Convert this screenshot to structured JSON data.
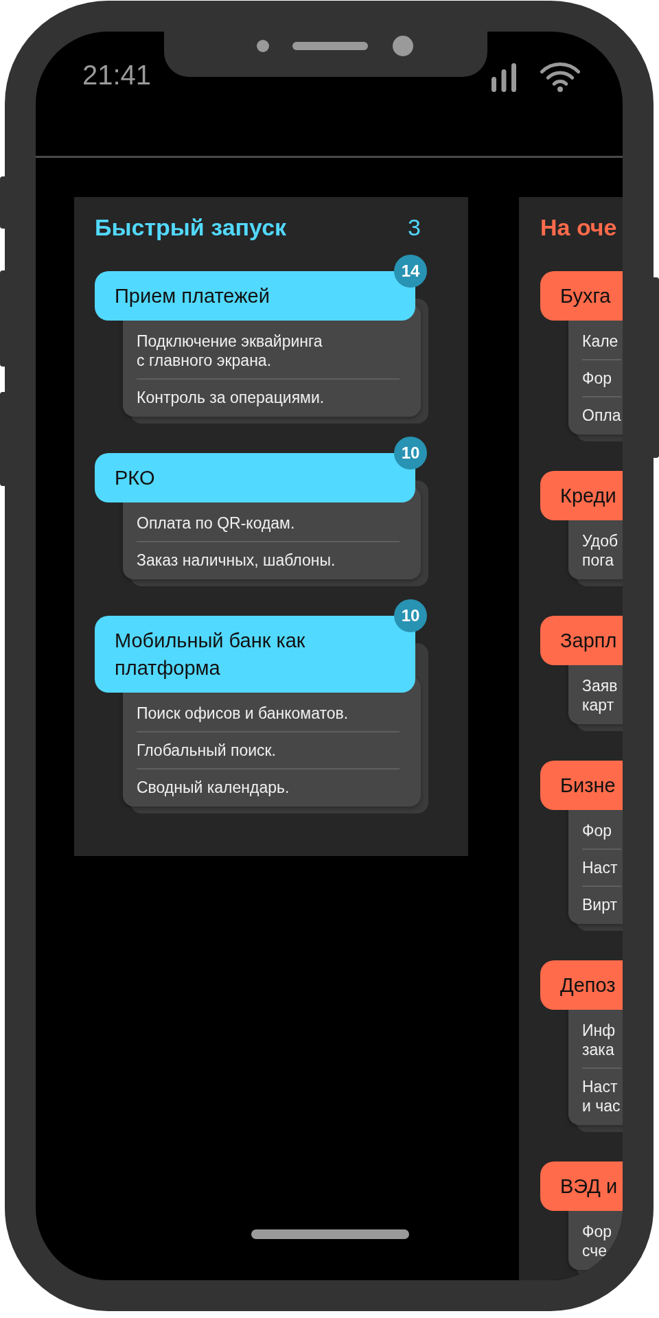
{
  "status_bar": {
    "time": "21:41"
  },
  "columns": [
    {
      "title": "Быстрый запуск",
      "count": "3",
      "color": "#52d9ff",
      "cards": [
        {
          "title": "Прием платежей",
          "badge": "14",
          "items": [
            "Подключение эквайринга\nс главного экрана.",
            "Контроль за операциями."
          ]
        },
        {
          "title": "РКО",
          "badge": "10",
          "items": [
            "Оплата по QR-кодам.",
            "Заказ наличных, шаблоны."
          ]
        },
        {
          "title": "Мобильный банк как\nплатформа",
          "badge": "10",
          "items": [
            "Поиск офисов и банкоматов.",
            "Глобальный поиск.",
            "Сводный календарь."
          ]
        }
      ]
    },
    {
      "title": "На оче",
      "color": "#ff6b4b",
      "cards": [
        {
          "title": "Бухга",
          "items": [
            "Кале",
            "Фор",
            "Опла"
          ]
        },
        {
          "title": "Креди",
          "items": [
            "Удоб\nпога"
          ]
        },
        {
          "title": "Зарпл",
          "items": [
            "Заяв\nкарт"
          ]
        },
        {
          "title": "Бизне",
          "items": [
            "Фор",
            "Наст",
            "Вирт"
          ]
        },
        {
          "title": "Депоз",
          "items": [
            "Инф\nзака",
            "Наст\nи час"
          ]
        },
        {
          "title": "ВЭД и",
          "items": [
            "Фор\nсче"
          ]
        }
      ]
    }
  ]
}
